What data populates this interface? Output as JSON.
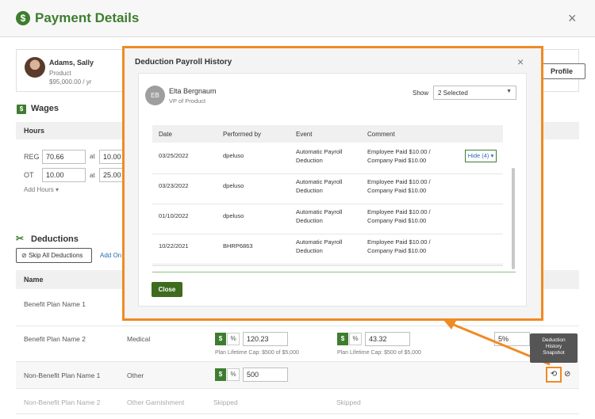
{
  "header": {
    "title": "Payment Details",
    "close": "×"
  },
  "employee": {
    "name": "Adams, Sally",
    "dept": "Product",
    "salary": "$95,000.00 / yr",
    "profile_button": "Profile"
  },
  "wages": {
    "title": "Wages",
    "hours_header": "Hours",
    "rows": [
      {
        "label": "REG",
        "value": "70.66",
        "at": "at",
        "rate": "10.00"
      },
      {
        "label": "OT",
        "value": "10.00",
        "at": "at",
        "rate": "25.00"
      }
    ],
    "add_hours": "Add Hours ▾"
  },
  "deductions": {
    "title": "Deductions",
    "skip_button": "Skip All Deductions",
    "add_link": "Add On",
    "column_name": "Name",
    "rows": [
      {
        "name": "Benefit Plan Name 1"
      },
      {
        "name": "Benefit Plan Name 2",
        "type": "Medical",
        "emp_value": "120.23",
        "co_value": "43.32",
        "cap1": "Plan Lifetime Cap: $500 of $5,000",
        "cap2": "Plan Lifetime Cap: $500 of $5,000",
        "pct": "5%"
      },
      {
        "name": "Non-Benefit Plan Name 1",
        "type": "Other",
        "emp_value": "500"
      },
      {
        "name": "Non-Benefit Plan Name 2",
        "type": "Other Garnishment",
        "emp_status": "Skipped",
        "co_status": "Skipped"
      }
    ]
  },
  "modal": {
    "title": "Deduction Payroll History",
    "close": "×",
    "person": {
      "initials": "EB",
      "name": "Elta Bergnaum",
      "title": "VP of Product"
    },
    "show_label": "Show",
    "show_value": "2 Selected",
    "columns": [
      "Date",
      "Performed by",
      "Event",
      "Comment"
    ],
    "rows": [
      {
        "date": "03/25/2022",
        "by": "dpeluso",
        "event1": "Automatic Payroll",
        "event2": "Deduction",
        "c1": "Employee Paid $10.00 /",
        "c2": "Company Paid $10.00"
      },
      {
        "date": "03/23/2022",
        "by": "dpeluso",
        "event1": "Automatic Payroll",
        "event2": "Deduction",
        "c1": "Employee Paid $10.00 /",
        "c2": "Company Paid $10.00"
      },
      {
        "date": "01/10/2022",
        "by": "dpeluso",
        "event1": "Automatic Payroll",
        "event2": "Deduction",
        "c1": "Employee Paid $10.00 /",
        "c2": "Company Paid $10.00"
      },
      {
        "date": "10/22/2021",
        "by": "BHRP6863",
        "event1": "Automatic Payroll",
        "event2": "Deduction",
        "c1": "Employee Paid $10.00 /",
        "c2": "Company Paid $10.00"
      }
    ],
    "hide_button": "Hide (4) ▾",
    "close_button": "Close"
  },
  "tooltip": {
    "l1": "Deduction",
    "l2": "History",
    "l3": "Snapshot"
  },
  "colors": {
    "brand_green": "#3e7d2f",
    "highlight_orange": "#f08a24"
  }
}
